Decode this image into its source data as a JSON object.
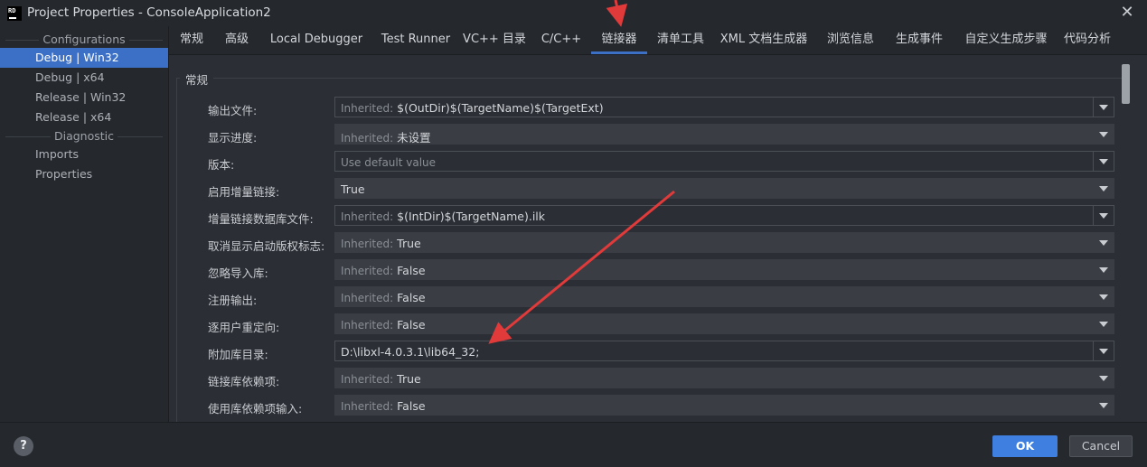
{
  "window": {
    "icon_text": "RD",
    "title": "Project Properties - ConsoleApplication2",
    "close_glyph": "✕"
  },
  "sidebar": {
    "configurations_header": "Configurations",
    "items": [
      {
        "label": "Debug | Win32",
        "selected": true
      },
      {
        "label": "Debug | x64"
      },
      {
        "label": "Release | Win32"
      },
      {
        "label": "Release | x64"
      }
    ],
    "diagnostic_header": "Diagnostic",
    "diagnostic_items": [
      {
        "label": "Imports"
      },
      {
        "label": "Properties"
      }
    ]
  },
  "tabs": [
    {
      "label": "常规"
    },
    {
      "label": "高级"
    },
    {
      "label": "Local Debugger"
    },
    {
      "label": "Test Runner"
    },
    {
      "label": "VC++ 目录"
    },
    {
      "label": "C/C++"
    },
    {
      "label": "链接器",
      "active": true
    },
    {
      "label": "清单工具"
    },
    {
      "label": "XML 文档生成器"
    },
    {
      "label": "浏览信息"
    },
    {
      "label": "生成事件"
    },
    {
      "label": "自定义生成步骤"
    },
    {
      "label": "代码分析"
    }
  ],
  "section": {
    "title": "常规",
    "rows": [
      {
        "label": "输出文件:",
        "inherited": "Inherited:",
        "value": "$(OutDir)$(TargetName)$(TargetExt)"
      },
      {
        "label": "显示进度:",
        "inherited": "Inherited:",
        "value": "未设置"
      },
      {
        "label": "版本:",
        "placeholder": "Use default value"
      },
      {
        "label": "启用增量链接:",
        "value": "True"
      },
      {
        "label": "增量链接数据库文件:",
        "inherited": "Inherited:",
        "value": "$(IntDir)$(TargetName).ilk"
      },
      {
        "label": "取消显示启动版权标志:",
        "inherited": "Inherited:",
        "value": "True"
      },
      {
        "label": "忽略导入库:",
        "inherited": "Inherited:",
        "value": "False"
      },
      {
        "label": "注册输出:",
        "inherited": "Inherited:",
        "value": "False"
      },
      {
        "label": "逐用户重定向:",
        "inherited": "Inherited:",
        "value": "False"
      },
      {
        "label": "附加库目录:",
        "value": "D:\\libxl-4.0.3.1\\lib64_32;"
      },
      {
        "label": "链接库依赖项:",
        "inherited": "Inherited:",
        "value": "True"
      },
      {
        "label": "使用库依赖项输入:",
        "inherited": "Inherited:",
        "value": "False"
      }
    ]
  },
  "footer": {
    "help_label": "?",
    "ok_label": "OK",
    "cancel_label": "Cancel"
  },
  "colors": {
    "accent": "#3c70c6",
    "ok_button": "#3f7fdf",
    "annotation_arrow": "#e03a3a"
  }
}
